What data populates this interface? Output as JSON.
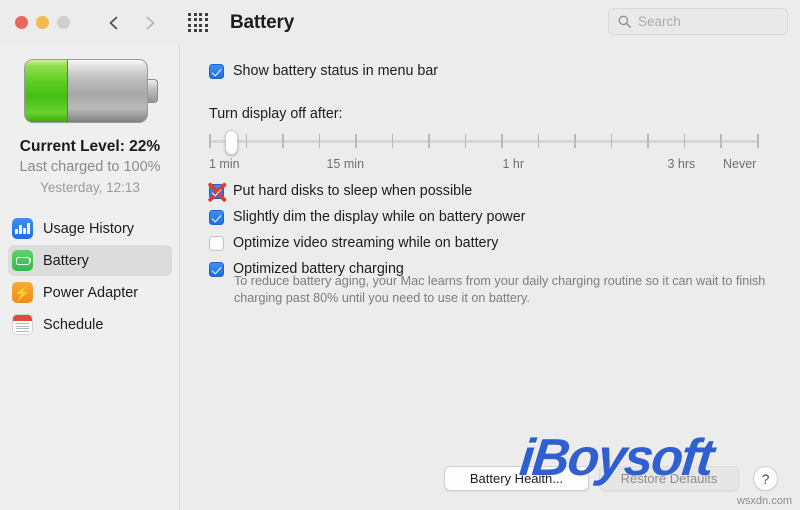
{
  "window": {
    "title": "Battery",
    "traffic_lights": [
      "close",
      "minimize",
      "zoom"
    ],
    "back_label": "Back",
    "forward_label": "Forward",
    "grid_label": "Show All"
  },
  "search": {
    "placeholder": "Search",
    "value": ""
  },
  "sidebar": {
    "battery": {
      "level_percent": 22,
      "fill_ratio": 0.35,
      "current_level_label": "Current Level: 22%",
      "last_charged_label": "Last charged to 100%",
      "last_charged_time": "Yesterday, 12:13"
    },
    "items": [
      {
        "label": "Usage History",
        "icon": "bar-chart-icon",
        "selected": false
      },
      {
        "label": "Battery",
        "icon": "battery-icon",
        "selected": true
      },
      {
        "label": "Power Adapter",
        "icon": "power-bolt-icon",
        "selected": false
      },
      {
        "label": "Schedule",
        "icon": "calendar-icon",
        "selected": false
      }
    ]
  },
  "main": {
    "show_status_checkbox": {
      "label": "Show battery status in menu bar",
      "checked": true
    },
    "display_off": {
      "label": "Turn display off after:",
      "thumb_position_percent": 4,
      "tick_count": 16,
      "scale_labels": [
        {
          "text": "1 min",
          "position_percent": 0
        },
        {
          "text": "15 min",
          "position_percent": 25
        },
        {
          "text": "1 hr",
          "position_percent": 57
        },
        {
          "text": "3 hrs",
          "position_percent": 87
        },
        {
          "text": "Never",
          "position_percent": 100
        }
      ]
    },
    "options": [
      {
        "label": "Put hard disks to sleep when possible",
        "checked": true,
        "marked_with_red_x": true
      },
      {
        "label": "Slightly dim the display while on battery power",
        "checked": true,
        "marked_with_red_x": false
      },
      {
        "label": "Optimize video streaming while on battery",
        "checked": false,
        "marked_with_red_x": false
      },
      {
        "label": "Optimized battery charging",
        "checked": true,
        "marked_with_red_x": false
      }
    ],
    "optimized_charging_description": "To reduce battery aging, your Mac learns from your daily charging routine so it can wait to finish charging past 80% until you need to use it on battery.",
    "buttons": {
      "battery_health": "Battery Health...",
      "restore_defaults": "Restore Defaults",
      "help": "?"
    }
  },
  "watermark": {
    "brand": "iBoysoft",
    "source": "wsxdn.com"
  },
  "colors": {
    "accent_blue": "#1d6fe8",
    "battery_green": "#46bf14",
    "power_orange": "#ef8c18",
    "mark_red": "#e03b2e",
    "brand_blue": "#2f5fd0"
  }
}
